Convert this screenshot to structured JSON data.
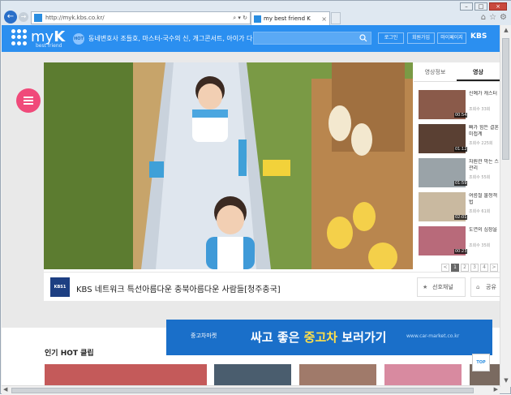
{
  "browser": {
    "url": "http://myk.kbs.co.kr/",
    "tab_title": "my best friend K",
    "window_controls": [
      "minimize",
      "maximize",
      "close"
    ]
  },
  "header": {
    "logo_text_light": "my",
    "logo_text_bold": "K",
    "logo_tagline": "best friend",
    "hot_badge": "HOT",
    "hot_text": "동네변호사 조들호, 마스터-국수의 신, 개그콘서트, 아이가 다섯",
    "search_placeholder": "",
    "login": "로그인",
    "signup": "회원가입",
    "mypage": "마이페이지",
    "kbs_logo": "KBS"
  },
  "player": {
    "side_tabs": [
      "영상정보",
      "영상"
    ],
    "active_tab_index": 1,
    "related": [
      {
        "title1": "신예가 캐스터",
        "title2": "",
        "views": "조회수 33회",
        "duration": "00:54",
        "color": "#8a5a4a"
      },
      {
        "title1": "빠가 힘든 결혼",
        "title2": "미첩계",
        "views": "조회수 225회",
        "duration": "01:12",
        "color": "#5a4033"
      },
      {
        "title1": "자원관 막는 스",
        "title2": "관리",
        "views": "조회수 55회",
        "duration": "01:59",
        "color": "#9aa3a8"
      },
      {
        "title1": "여름철 불청객",
        "title2": "법",
        "views": "조회수 61회",
        "duration": "02:01",
        "color": "#c9b9a0"
      },
      {
        "title1": "도연의 심장을",
        "title2": "",
        "views": "조회수 35회",
        "duration": "00:23",
        "color": "#b86a7a"
      }
    ],
    "pager": [
      "<",
      "1",
      "2",
      "3",
      "4",
      ">"
    ],
    "channel_badge": "KBS1",
    "caption": "KBS 네트워크 특선아름다운 충북아름다운 사람들[청주충국]",
    "pref_label": "선호채널",
    "share_label": "공유"
  },
  "below": {
    "banner_brand": "중고차마켓",
    "banner_text_a": "싸고 좋은 ",
    "banner_text_b": "중고차",
    "banner_text_c": " 보러가기",
    "banner_url": "www.car-market.co.kr",
    "hot_clips_title": "인기 HOT 클립",
    "top_button": "TOP"
  }
}
